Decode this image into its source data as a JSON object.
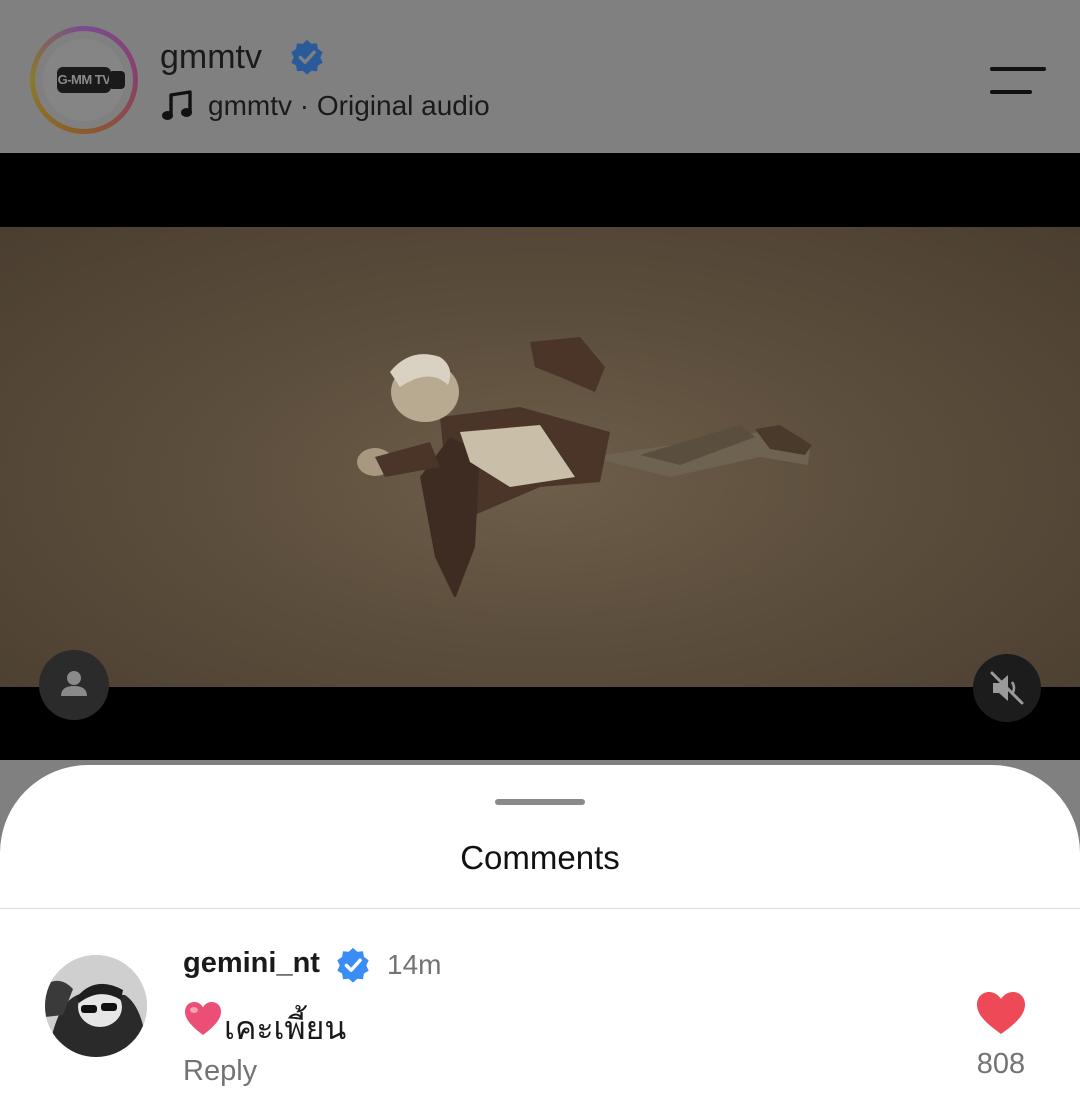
{
  "header": {
    "username": "gmmtv",
    "audio": "gmmtv · Original audio",
    "avatar_logo": "G-MM TV"
  },
  "icons": {
    "verified": "verified-badge-icon",
    "music": "music-note-icon",
    "menu": "menu-icon",
    "user": "user-tag-icon",
    "mute": "speaker-muted-icon",
    "like": "heart-icon"
  },
  "sheet": {
    "title": "Comments"
  },
  "comments": [
    {
      "username": "gemini_nt",
      "time": "14m",
      "text": "เคะเพี้ยน",
      "reply_label": "Reply",
      "likes": "808"
    }
  ],
  "colors": {
    "verified_blue": "#3a8df5",
    "like_red": "#ed4956",
    "dim_overlay": "#808080"
  }
}
